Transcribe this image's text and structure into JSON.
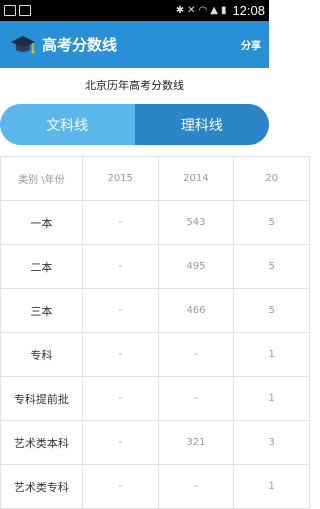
{
  "status_bar": {
    "time": "12:08"
  },
  "app_bar": {
    "title": "高考分数线",
    "share_label": "分享"
  },
  "page": {
    "subtitle": "北京历年高考分数线"
  },
  "toggle": {
    "tabs": [
      {
        "label": "文科线",
        "selected": false
      },
      {
        "label": "理科线",
        "selected": true
      }
    ]
  },
  "table": {
    "corner_label": "类别 \\年份",
    "years": [
      "2015",
      "2014",
      "20"
    ],
    "rows": [
      {
        "category": "一本",
        "values": [
          "-",
          "543",
          "5"
        ]
      },
      {
        "category": "二本",
        "values": [
          "-",
          "495",
          "5"
        ]
      },
      {
        "category": "三本",
        "values": [
          "-",
          "466",
          "5"
        ]
      },
      {
        "category": "专科",
        "values": [
          "-",
          "-",
          "1"
        ]
      },
      {
        "category": "专科提前批",
        "values": [
          "-",
          "-",
          "1"
        ]
      },
      {
        "category": "艺术类本科",
        "values": [
          "-",
          "321",
          "3"
        ]
      },
      {
        "category": "艺术类专科",
        "values": [
          "-",
          "-",
          "1"
        ]
      }
    ]
  },
  "colors": {
    "app_bar": "#2a90d6",
    "tab_unselected": "#5db6ea",
    "tab_selected": "#2b85c6"
  }
}
